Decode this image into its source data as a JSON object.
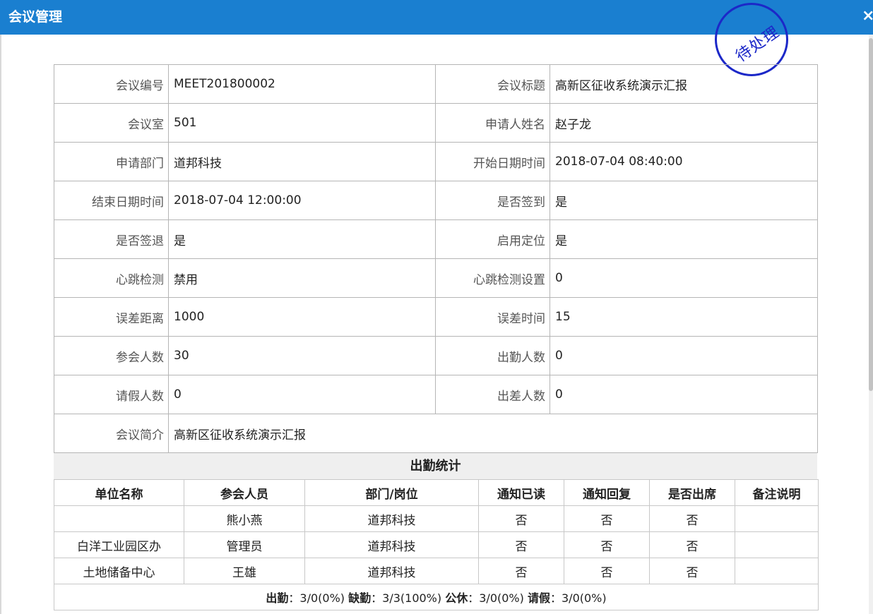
{
  "window": {
    "title": "会议管理",
    "close_label": "×"
  },
  "stamp": {
    "text": "待处理"
  },
  "meeting": {
    "rows": [
      [
        {
          "label": "会议编号",
          "value": "MEET201800002"
        },
        {
          "label": "会议标题",
          "value": "高新区征收系统演示汇报"
        }
      ],
      [
        {
          "label": "会议室",
          "value": "501"
        },
        {
          "label": "申请人姓名",
          "value": "赵子龙"
        }
      ],
      [
        {
          "label": "申请部门",
          "value": "道邦科技"
        },
        {
          "label": "开始日期时间",
          "value": "2018-07-04 08:40:00"
        }
      ],
      [
        {
          "label": "结束日期时间",
          "value": "2018-07-04 12:00:00"
        },
        {
          "label": "是否签到",
          "value": "是"
        }
      ],
      [
        {
          "label": "是否签退",
          "value": "是"
        },
        {
          "label": "启用定位",
          "value": "是"
        }
      ],
      [
        {
          "label": "心跳检测",
          "value": "禁用"
        },
        {
          "label": "心跳检测设置",
          "value": "0"
        }
      ],
      [
        {
          "label": "误差距离",
          "value": "1000"
        },
        {
          "label": "误差时间",
          "value": "15"
        }
      ],
      [
        {
          "label": "参会人数",
          "value": "30"
        },
        {
          "label": "出勤人数",
          "value": "0"
        }
      ],
      [
        {
          "label": "请假人数",
          "value": "0"
        },
        {
          "label": "出差人数",
          "value": "0"
        }
      ]
    ],
    "summary": {
      "label": "会议简介",
      "value": "高新区征收系统演示汇报"
    }
  },
  "attendance": {
    "title": "出勤统计",
    "headers": [
      "单位名称",
      "参会人员",
      "部门/岗位",
      "通知已读",
      "通知回复",
      "是否出席",
      "备注说明"
    ],
    "rows": [
      [
        "",
        "熊小燕",
        "道邦科技",
        "否",
        "否",
        "否",
        ""
      ],
      [
        "白洋工业园区办",
        "管理员",
        "道邦科技",
        "否",
        "否",
        "否",
        ""
      ],
      [
        "土地储备中心",
        "王雄",
        "道邦科技",
        "否",
        "否",
        "否",
        ""
      ]
    ],
    "summary": {
      "present_label": "出勤",
      "present_value": "3/0(0%)",
      "absent_label": "缺勤",
      "absent_value": "3/3(100%)",
      "business_label": "公休",
      "business_value": "3/0(0%)",
      "leave_label": "请假",
      "leave_value": "3/0(0%)",
      "separator": "："
    }
  }
}
